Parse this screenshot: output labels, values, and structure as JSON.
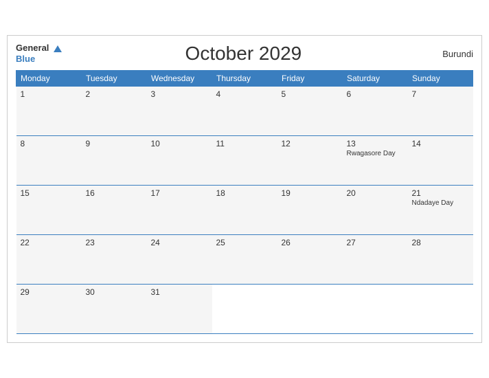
{
  "header": {
    "logo_general": "General",
    "logo_blue": "Blue",
    "title": "October 2029",
    "country": "Burundi"
  },
  "days_of_week": [
    "Monday",
    "Tuesday",
    "Wednesday",
    "Thursday",
    "Friday",
    "Saturday",
    "Sunday"
  ],
  "weeks": [
    [
      {
        "day": "1",
        "holiday": ""
      },
      {
        "day": "2",
        "holiday": ""
      },
      {
        "day": "3",
        "holiday": ""
      },
      {
        "day": "4",
        "holiday": ""
      },
      {
        "day": "5",
        "holiday": ""
      },
      {
        "day": "6",
        "holiday": ""
      },
      {
        "day": "7",
        "holiday": ""
      }
    ],
    [
      {
        "day": "8",
        "holiday": ""
      },
      {
        "day": "9",
        "holiday": ""
      },
      {
        "day": "10",
        "holiday": ""
      },
      {
        "day": "11",
        "holiday": ""
      },
      {
        "day": "12",
        "holiday": ""
      },
      {
        "day": "13",
        "holiday": "Rwagasore Day"
      },
      {
        "day": "14",
        "holiday": ""
      }
    ],
    [
      {
        "day": "15",
        "holiday": ""
      },
      {
        "day": "16",
        "holiday": ""
      },
      {
        "day": "17",
        "holiday": ""
      },
      {
        "day": "18",
        "holiday": ""
      },
      {
        "day": "19",
        "holiday": ""
      },
      {
        "day": "20",
        "holiday": ""
      },
      {
        "day": "21",
        "holiday": "Ndadaye Day"
      }
    ],
    [
      {
        "day": "22",
        "holiday": ""
      },
      {
        "day": "23",
        "holiday": ""
      },
      {
        "day": "24",
        "holiday": ""
      },
      {
        "day": "25",
        "holiday": ""
      },
      {
        "day": "26",
        "holiday": ""
      },
      {
        "day": "27",
        "holiday": ""
      },
      {
        "day": "28",
        "holiday": ""
      }
    ],
    [
      {
        "day": "29",
        "holiday": ""
      },
      {
        "day": "30",
        "holiday": ""
      },
      {
        "day": "31",
        "holiday": ""
      },
      {
        "day": "",
        "holiday": ""
      },
      {
        "day": "",
        "holiday": ""
      },
      {
        "day": "",
        "holiday": ""
      },
      {
        "day": "",
        "holiday": ""
      }
    ]
  ]
}
